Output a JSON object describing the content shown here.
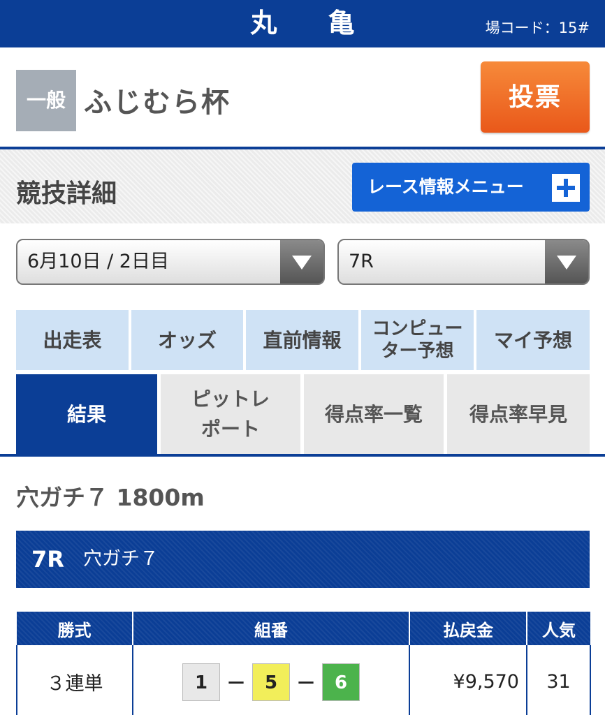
{
  "header": {
    "venue": "丸 亀",
    "venue_code": "場コード：15#"
  },
  "race": {
    "grade": "一般",
    "name": "ふじむら杯",
    "vote_label": "投票"
  },
  "detail": {
    "title": "競技詳細",
    "menu_label": "レース情報メニュー",
    "menu_icon": "plus-icon"
  },
  "selects": {
    "date": "6月10日 / 2日目",
    "race": "7R"
  },
  "tabs_row1": [
    {
      "label": "出走表"
    },
    {
      "label": "オッズ"
    },
    {
      "label": "直前情報"
    },
    {
      "label": "コンピュー\nター予想"
    },
    {
      "label": "マイ予想"
    }
  ],
  "tabs_row2": [
    {
      "label": "結果"
    },
    {
      "label": "ピットレ\nポート"
    },
    {
      "label": "得点率一覧"
    },
    {
      "label": "得点率早見"
    }
  ],
  "course": {
    "title": "穴ガチ７ 1800m"
  },
  "race_bar": {
    "number": "7R",
    "name": "穴ガチ７"
  },
  "result_table": {
    "headers": [
      "勝式",
      "組番",
      "払戻金",
      "人気"
    ],
    "rows": [
      {
        "type": "３連単",
        "boats": [
          "1",
          "5",
          "6"
        ],
        "boat_colors": [
          "#e8e8e8",
          "#f2ee5a",
          "#4cb34c"
        ],
        "payout": "¥9,570",
        "popularity": "31"
      }
    ]
  },
  "colors": {
    "brand": "#0b3e96",
    "vote": "#f26e22",
    "menu": "#1463d6"
  }
}
